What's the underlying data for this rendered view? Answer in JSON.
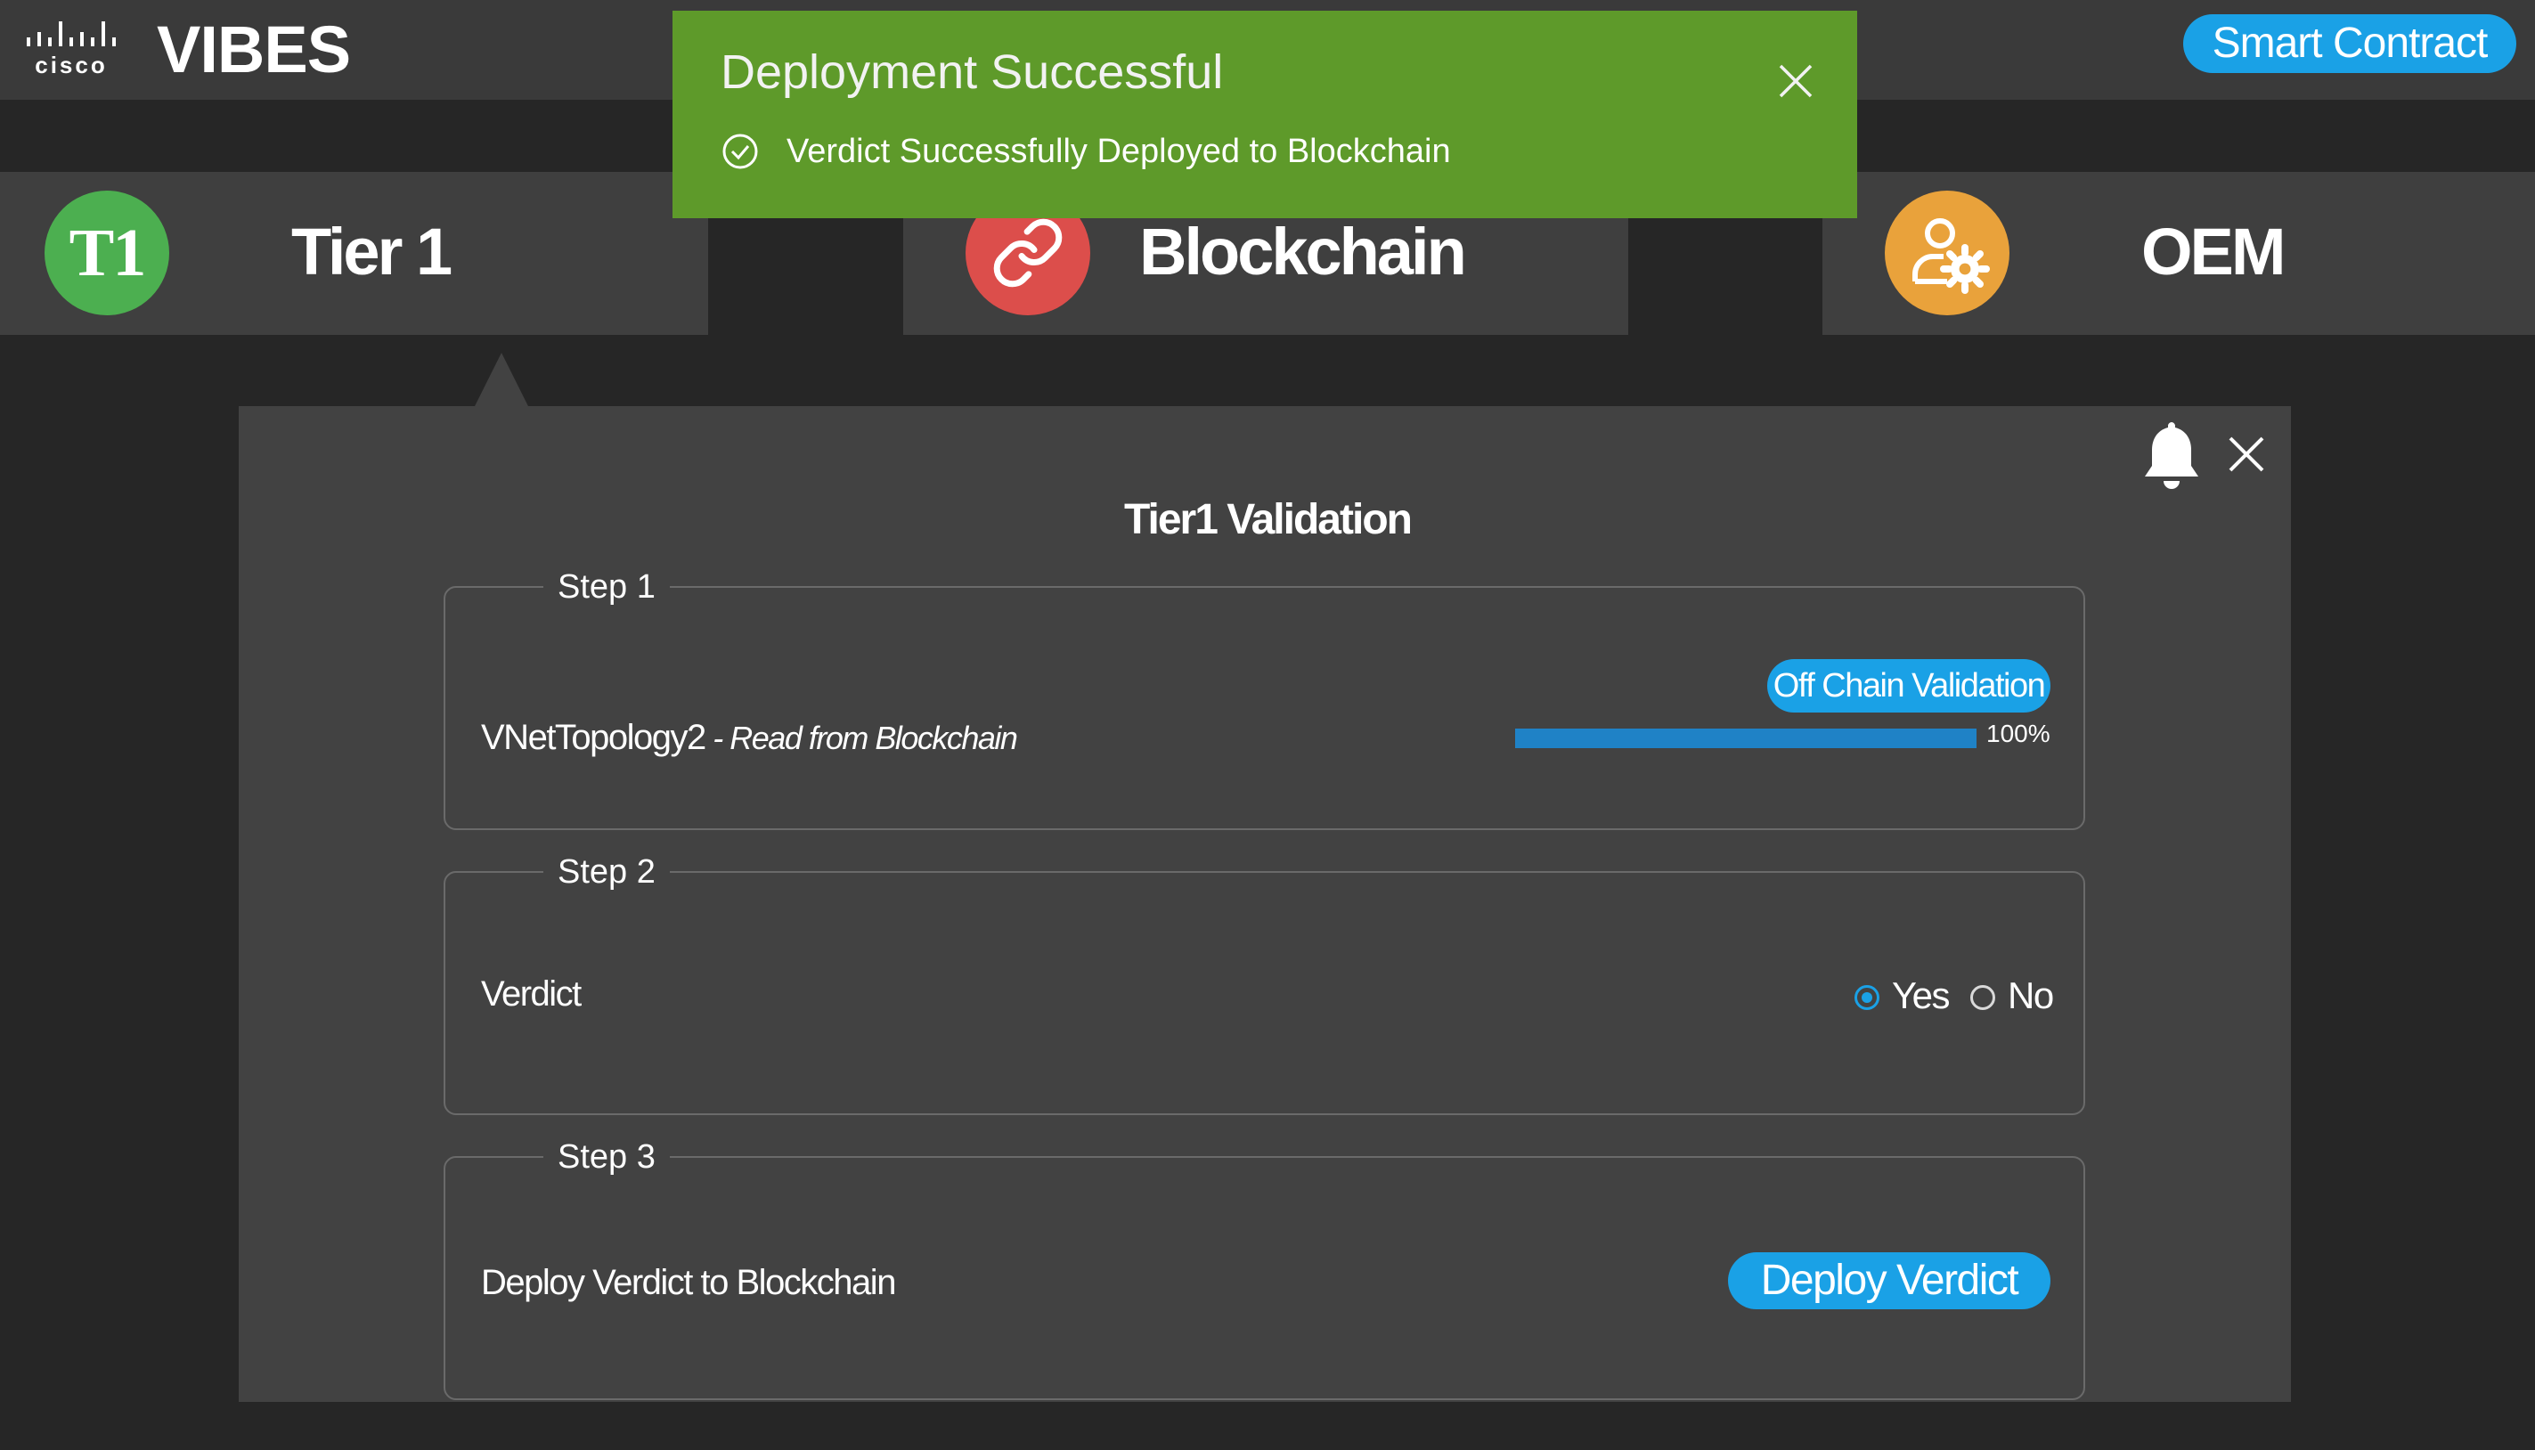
{
  "header": {
    "logo_text": "cisco",
    "app_title": "VIBES",
    "smart_contract_button": "Smart Contract"
  },
  "tiles": [
    {
      "id": "tier1",
      "label": "Tier 1",
      "badge_text": "T1",
      "icon": "tier1-badge-icon",
      "color": "#4caf50"
    },
    {
      "id": "blockchain",
      "label": "Blockchain",
      "icon": "link-icon",
      "color": "#dc4e4b"
    },
    {
      "id": "oem",
      "label": "OEM",
      "icon": "user-gear-icon",
      "color": "#e9a23b"
    }
  ],
  "toast": {
    "title": "Deployment Successful",
    "message": "Verdict Successfully Deployed to Blockchain",
    "icon": "check-circle-icon",
    "color": "#5e9a2a"
  },
  "panel": {
    "title": "Tier1 Validation",
    "steps": [
      {
        "legend": "Step 1",
        "text": "VNetTopology2",
        "text_italic": " - Read from Blockchain",
        "action_label": "Off Chain Validation",
        "progress_percent": 100,
        "progress_label": "100%"
      },
      {
        "legend": "Step 2",
        "text": "Verdict",
        "options": [
          "Yes",
          "No"
        ],
        "selected": "Yes"
      },
      {
        "legend": "Step 3",
        "text": "Deploy Verdict to Blockchain",
        "action_label": "Deploy Verdict"
      }
    ]
  },
  "colors": {
    "accent": "#1aa1e6",
    "background": "#262626",
    "panel": "#424242"
  }
}
